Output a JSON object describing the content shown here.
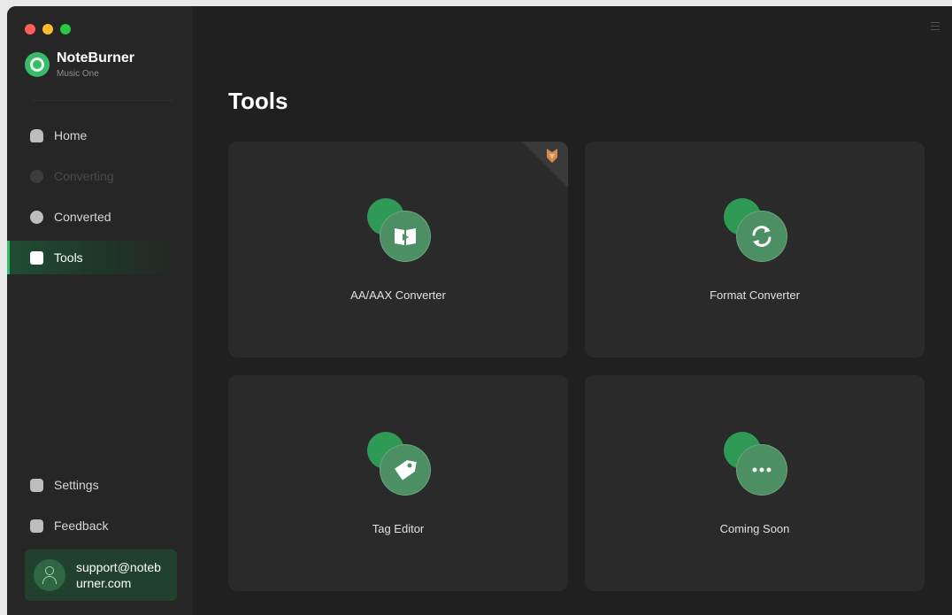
{
  "app": {
    "name": "NoteBurner",
    "subtitle": "Music One",
    "traffic_colors": [
      "#fe5f57",
      "#febc2e",
      "#28c840"
    ],
    "accent": "#39b96a"
  },
  "sidebar": {
    "items": [
      {
        "label": "Home",
        "icon": "home-icon",
        "state": "normal"
      },
      {
        "label": "Converting",
        "icon": "converting-icon",
        "state": "disabled"
      },
      {
        "label": "Converted",
        "icon": "clock-icon",
        "state": "normal"
      },
      {
        "label": "Tools",
        "icon": "toolbox-icon",
        "state": "active"
      }
    ],
    "bottom_items": [
      {
        "label": "Settings",
        "icon": "gear-icon"
      },
      {
        "label": "Feedback",
        "icon": "mail-icon"
      }
    ],
    "user": {
      "email": "support@noteburner.com",
      "icon": "user-icon"
    }
  },
  "main": {
    "title": "Tools",
    "menu_icon": "hamburger-menu-icon",
    "tools": [
      {
        "label": "AA/AAX Converter",
        "icon": "audiobook-play-icon",
        "badge": "fox-pro-badge-icon"
      },
      {
        "label": "Format Converter",
        "icon": "refresh-convert-icon"
      },
      {
        "label": "Tag Editor",
        "icon": "tag-icon"
      },
      {
        "label": "Coming Soon",
        "icon": "more-dots-icon"
      }
    ]
  }
}
